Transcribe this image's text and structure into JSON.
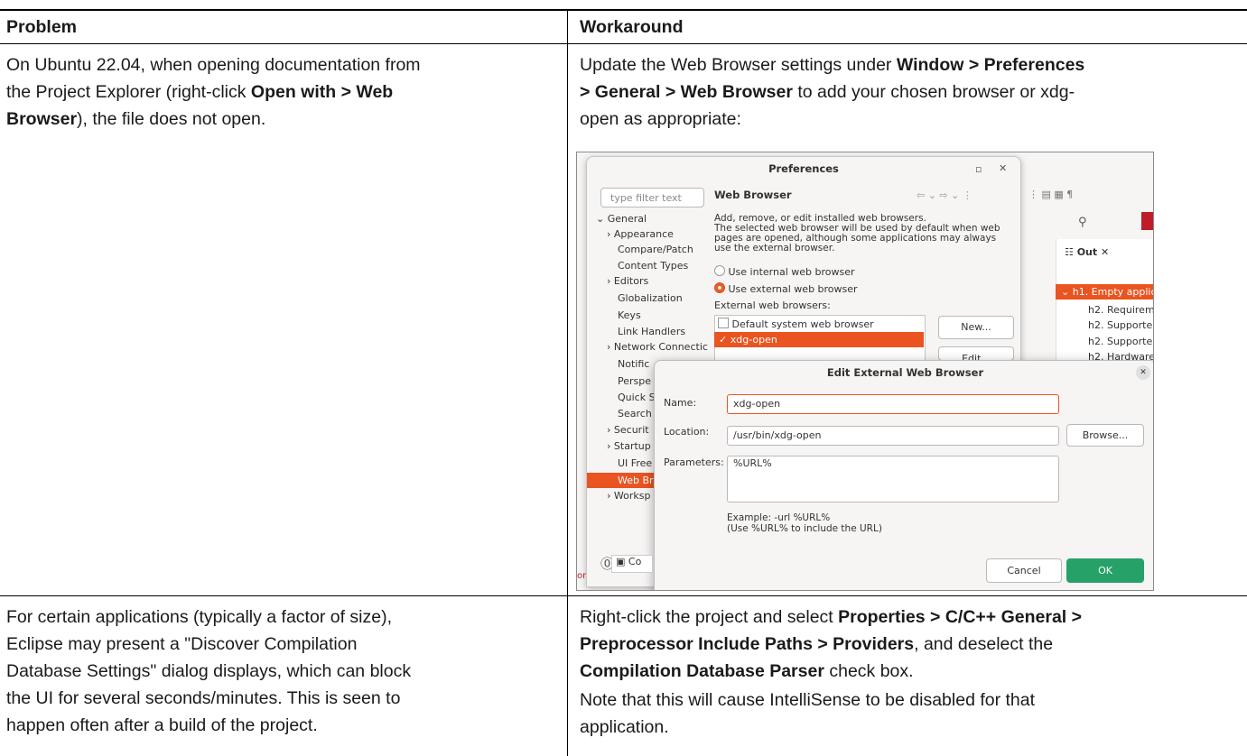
{
  "table": {
    "headers": [
      "Problem",
      "Workaround"
    ],
    "row1": {
      "problem_parts": [
        "On Ubuntu 22.04, when opening documentation from",
        "the Project Explorer (right-click ",
        "Open with > Web",
        "Browser",
        "), the file does not open."
      ],
      "workaround_parts": [
        "Update the Web Browser settings under ",
        "Window > Preferences",
        "> General > Web Browser",
        " to add your chosen browser or xdg-",
        "open as appropriate:"
      ]
    },
    "row2": {
      "problem_lines": [
        "For certain applications (typically a factor of size),",
        "Eclipse may present a \"Discover Compilation",
        "Database Settings\" dialog displays, which can block",
        "the UI for several seconds/minutes. This is seen to",
        "happen often after a build of the project."
      ],
      "workaround_parts": [
        "Right-click the project and select ",
        "Properties > C/C++ General >",
        "Preprocessor Include Paths > Providers",
        ", and deselect the",
        "Compilation Database Parser",
        " check box."
      ],
      "note_lines": [
        "Note that this will cause IntelliSense to be disabled for that",
        "application."
      ]
    }
  },
  "screenshot": {
    "prefs": {
      "title": "Preferences",
      "filter_placeholder": "type filter text",
      "page_title": "Web Browser",
      "description": [
        "Add, remove, or edit installed web browsers.",
        "The selected web browser will be used by default when web",
        "pages are opened, although some applications may always",
        "use the external browser."
      ],
      "radio_internal": "Use internal web browser",
      "radio_external": "Use external web browser",
      "external_label": "External web browsers:",
      "browsers": [
        "Default system web browser",
        "xdg-open"
      ],
      "new_button": "New...",
      "edit_button": "Edit...",
      "tree": [
        "General",
        "Appearance",
        "Compare/Patch",
        "Content Types",
        "Editors",
        "Globalization",
        "Keys",
        "Link Handlers",
        "Network Connectic",
        "Notific",
        "Perspe",
        "Quick S",
        "Search",
        "Securit",
        "Startup",
        "UI Free",
        "Web Br",
        "Worksp"
      ]
    },
    "ide": {
      "outline_tab": "Out",
      "outline_items": [
        "h1. Empty applic",
        "h2. Requireme",
        "h2. Supporte",
        "h2. Supporte",
        "h2. Hardware"
      ],
      "bottom_tab": "Co",
      "bottom_left_text": "on In-Pl"
    },
    "edit_dialog": {
      "title": "Edit External Web Browser",
      "name_label": "Name:",
      "name_value": "xdg-open",
      "location_label": "Location:",
      "location_value": "/usr/bin/xdg-open",
      "browse_button": "Browse...",
      "parameters_label": "Parameters:",
      "parameters_value": "%URL%",
      "example_line1": "Example: -url %URL%",
      "example_line2": "(Use %URL% to include the URL)",
      "cancel_button": "Cancel",
      "ok_button": "OK"
    }
  },
  "colors": {
    "accent": "#e95420",
    "ok_green": "#26a269"
  }
}
